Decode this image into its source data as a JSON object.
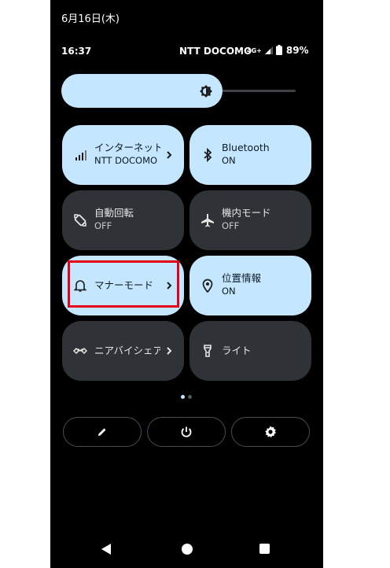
{
  "status_bar": {
    "date": "6月16日(木)",
    "time": "16:37",
    "carrier": "NTT DOCOMO",
    "network": "4G+",
    "battery": "89%"
  },
  "brightness": {
    "level": 0.62,
    "icon": "brightness-auto-icon"
  },
  "tiles": [
    {
      "label": "インターネット",
      "sub": "NTT DOCOMO",
      "state": "on",
      "icon": "signal-icon",
      "has_chevron": true
    },
    {
      "label": "Bluetooth",
      "sub": "ON",
      "state": "on",
      "icon": "bluetooth-icon",
      "has_chevron": false
    },
    {
      "label": "自動回転",
      "sub": "OFF",
      "state": "off",
      "icon": "auto-rotate-icon",
      "has_chevron": false
    },
    {
      "label": "機内モード",
      "sub": "OFF",
      "state": "off",
      "icon": "airplane-icon",
      "has_chevron": false
    },
    {
      "label": "マナーモード",
      "sub": "",
      "state": "on",
      "icon": "bell-icon",
      "has_chevron": true
    },
    {
      "label": "位置情報",
      "sub": "ON",
      "state": "on",
      "icon": "location-pin-icon",
      "has_chevron": false
    },
    {
      "label": "ニアバイシェア",
      "sub": "",
      "state": "off",
      "icon": "nearby-share-icon",
      "has_chevron": true
    },
    {
      "label": "ライト",
      "sub": "",
      "state": "off",
      "icon": "flashlight-icon",
      "has_chevron": false
    }
  ],
  "page_indicator": {
    "pages": 2,
    "current": 1
  },
  "footer_buttons": [
    {
      "name": "edit",
      "icon": "pencil-icon"
    },
    {
      "name": "power",
      "icon": "power-icon"
    },
    {
      "name": "settings",
      "icon": "gear-icon"
    }
  ],
  "nav_bar": {
    "back": "back-icon",
    "home": "home-icon",
    "recents": "recents-icon"
  },
  "colors": {
    "tile_on": "#c4e7ff",
    "tile_off": "#2f3237",
    "highlight": "#e2001a"
  }
}
